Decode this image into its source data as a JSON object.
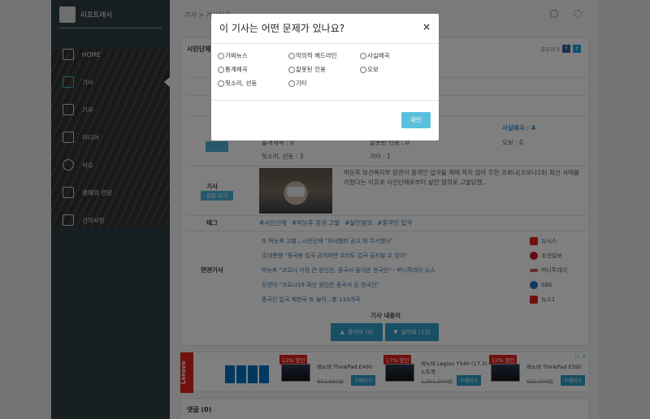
{
  "app": {
    "brand": "리포트래시"
  },
  "topbar": {
    "breadcrumb": "기사 > 기사상세"
  },
  "sidebar": {
    "items": [
      {
        "label": "HOME",
        "icon": "home-icon"
      },
      {
        "label": "기사",
        "icon": "article-icon",
        "active": true
      },
      {
        "label": "기자",
        "icon": "reporter-icon"
      },
      {
        "label": "미디어",
        "icon": "media-icon"
      },
      {
        "label": "이슈",
        "icon": "info-icon"
      },
      {
        "label": "명예의 전당",
        "icon": "diamond-icon"
      },
      {
        "label": "건의사항",
        "icon": "suggestion-icon"
      }
    ]
  },
  "article": {
    "title_partial": "시민단체,",
    "share_label": "공유하기",
    "stats": {
      "a": "불개제목 : 0",
      "b": "잘못된 인용 : 0",
      "c": "사실왜곡 : 4",
      "d": "오보 : 0",
      "e": "헛소리, 선동 : 3",
      "f": "기타 : 1"
    },
    "article_label": "기사",
    "view_original": "원문 보기",
    "summary": "박능후 보건복지부 장관이 중국인 입국을 제때 막지 않아 우한 코로나(코로나19) 확산 사태를 키웠다는 이유로 시민단체로부터 살인 혐의로 고발당했..",
    "tags_label": "태그",
    "tags": [
      "#시민단체",
      "#박능후 장관 고발",
      "#살인혐의",
      "#중국인 입국"
    ],
    "related_label": "연관기사",
    "related": [
      {
        "title": "또 박능후 고발...시민단체 \"의사협회 권고 왜 무시했나\"",
        "source": "뉴시스",
        "color": "#e2231a"
      },
      {
        "title": "文대통령 \"중국봉 입국 금지하면 우리도 입국 금지될 수 있어\"",
        "source": "조선일보",
        "color": "#c8102e"
      },
      {
        "title": "박능후 \"코로나 가장 큰 원인은, 중국서 들어온 한국인\" - 머니투데이 뉴스",
        "source": "머니투데이",
        "color": "#d9534f"
      },
      {
        "title": "장관이 \"코로나19 확산 원인은 중국서 온 한국인\"",
        "source": "SBS",
        "color": "#1e73be"
      },
      {
        "title": "중국인 입국 제한국 또 늘어...총 133개국",
        "source": "뉴스1",
        "color": "#e2231a"
      }
    ],
    "content_label": "기사 내용이",
    "like_label": "좋아요 (0)",
    "dislike_label": "싫어요 (13)"
  },
  "ad": {
    "brand": "Lenovo",
    "products": [
      {
        "tag": "12% 할인",
        "name": "레노버 ThinkPad E490",
        "old_price": "853,600원",
        "buy": "구매하기"
      },
      {
        "tag": "17% 할인",
        "name": "레노버 Legion Y540 (17.3) 노트북",
        "old_price": "1,351,900원",
        "buy": "구매하기"
      },
      {
        "tag": "12% 할인",
        "name": "레노버 ThinkPad E595",
        "old_price": "662,200원",
        "buy": "구매하기"
      }
    ]
  },
  "comments": {
    "label": "댓글 (0)"
  },
  "modal": {
    "title": "이 기사는 어떤 문제가 있나요?",
    "close": "×",
    "options": [
      "가짜뉴스",
      "악의적 헤드라인",
      "사실왜곡",
      "통계왜곡",
      "잘못된 인용",
      "오보",
      "헛소리, 선동",
      "기타"
    ],
    "confirm": "확인"
  }
}
